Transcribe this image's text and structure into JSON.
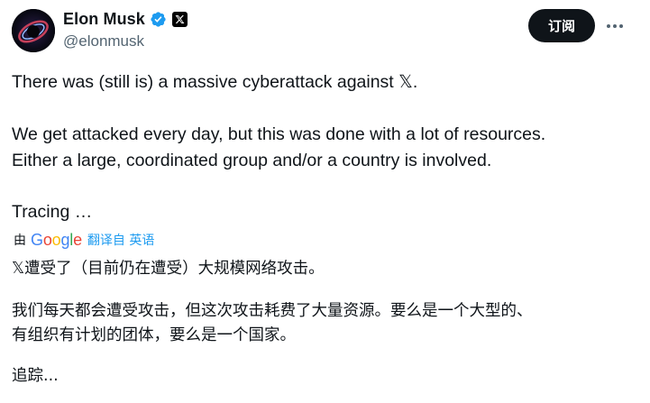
{
  "author": {
    "display_name": "Elon Musk",
    "handle": "@elonmusk"
  },
  "icons": {
    "verified": "verified-badge-icon",
    "affiliation": "x-affiliation-icon",
    "more": "more-icon"
  },
  "actions": {
    "subscribe_label": "订阅"
  },
  "original_text": {
    "p1": "There was (still is) a massive cyberattack against 𝕏.",
    "p2_line1": "We get attacked every day, but this was done with a lot of resources.",
    "p2_line2": "Either a large, coordinated group and/or a country is involved.",
    "p3": "Tracing …"
  },
  "translation": {
    "by_label": "由",
    "provider": "Google",
    "link_label": "翻译自 英语"
  },
  "translated_text": {
    "p1": "𝕏遭受了（目前仍在遭受）大规模网络攻击。",
    "p2_line1": "我们每天都会遭受攻击，但这次攻击耗费了大量资源。要么是一个大型的、",
    "p2_line2": "有组织有计划的团体，要么是一个国家。",
    "p3": "追踪..."
  },
  "colors": {
    "text": "#0f1419",
    "secondary": "#536471",
    "link": "#1d9bf0",
    "verified": "#1d9bf0",
    "button_bg": "#0f1419"
  }
}
